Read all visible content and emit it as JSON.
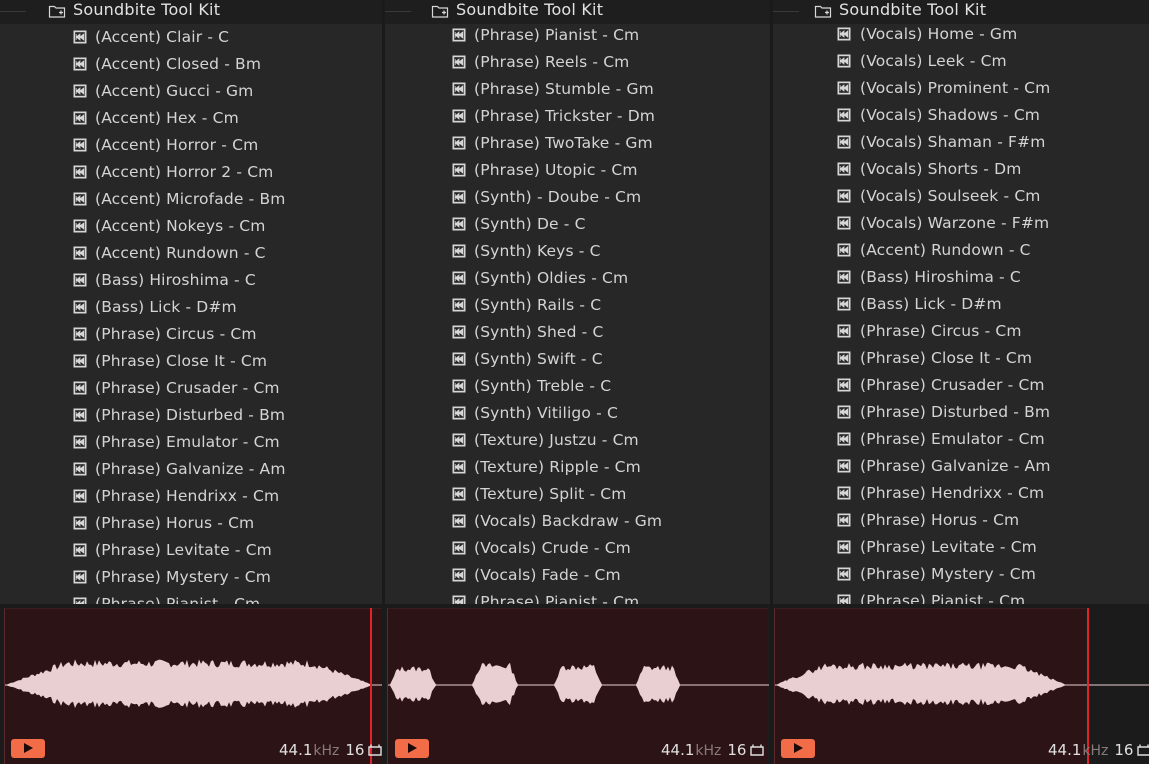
{
  "panels": [
    {
      "folder_title": "Soundbite Tool Kit",
      "items": [
        "(Accent) Clair - C",
        "(Accent) Closed - Bm",
        "(Accent) Gucci - Gm",
        "(Accent) Hex - Cm",
        "(Accent) Horror - Cm",
        "(Accent) Horror 2 - Cm",
        "(Accent) Microfade - Bm",
        "(Accent) Nokeys - Cm",
        "(Accent) Rundown - C",
        "(Bass) Hiroshima - C",
        "(Bass) Lick - D#m",
        "(Phrase) Circus - Cm",
        "(Phrase) Close It - Cm",
        "(Phrase) Crusader - Cm",
        "(Phrase) Disturbed - Bm",
        "(Phrase) Emulator - Cm",
        "(Phrase) Galvanize - Am",
        "(Phrase) Hendrixx - Cm",
        "(Phrase) Horus - Cm",
        "(Phrase) Levitate - Cm",
        "(Phrase) Mystery - Cm",
        "(Phrase) Pianist - Cm"
      ],
      "sample_rate": "44.1",
      "rate_unit": "kHz",
      "bit_depth": "16"
    },
    {
      "folder_title": "Soundbite Tool Kit",
      "items": [
        "(Phrase) Pianist - Cm",
        "(Phrase) Reels - Cm",
        "(Phrase) Stumble - Gm",
        "(Phrase) Trickster - Dm",
        "(Phrase) TwoTake - Gm",
        "(Phrase) Utopic - Cm",
        "(Synth) - Doube - Cm",
        "(Synth) De - C",
        "(Synth) Keys - C",
        "(Synth) Oldies - Cm",
        "(Synth) Rails - C",
        "(Synth) Shed - C",
        "(Synth) Swift - C",
        "(Synth) Treble - C",
        "(Synth) Vitiligo - C",
        "(Texture) Justzu - Cm",
        "(Texture) Ripple - Cm",
        "(Texture) Split - Cm",
        "(Vocals) Backdraw - Gm",
        "(Vocals) Crude - Cm",
        "(Vocals) Fade - Cm",
        "(Phrase) Pianist - Cm"
      ],
      "sample_rate": "44.1",
      "rate_unit": "kHz",
      "bit_depth": "16"
    },
    {
      "folder_title": "Soundbite Tool Kit",
      "items": [
        "(Vocals) Home - Gm",
        "(Vocals) Leek - Cm",
        "(Vocals) Prominent - Cm",
        "(Vocals) Shadows - Cm",
        "(Vocals) Shaman - F#m",
        "(Vocals) Shorts - Dm",
        "(Vocals) Soulseek - Cm",
        "(Vocals) Warzone - F#m",
        "(Accent) Rundown - C",
        "(Bass) Hiroshima - C",
        "(Bass) Lick - D#m",
        "(Phrase) Circus - Cm",
        "(Phrase) Close It - Cm",
        "(Phrase) Crusader - Cm",
        "(Phrase) Disturbed - Bm",
        "(Phrase) Emulator - Cm",
        "(Phrase) Galvanize - Am",
        "(Phrase) Hendrixx - Cm",
        "(Phrase) Horus - Cm",
        "(Phrase) Levitate - Cm",
        "(Phrase) Mystery - Cm",
        "(Phrase) Pianist - Cm"
      ],
      "sample_rate": "44.1",
      "rate_unit": "kHz",
      "bit_depth": "16"
    }
  ],
  "icons": {
    "folder": "folder-plus-icon",
    "item": "audio-clip-icon",
    "play": "play-icon",
    "loop": "loop-icon"
  },
  "colors": {
    "waveform": "#e9cfd1",
    "wave_bg": "#2c1315",
    "playhead": "#e3232c",
    "play_button": "#f26c47"
  }
}
